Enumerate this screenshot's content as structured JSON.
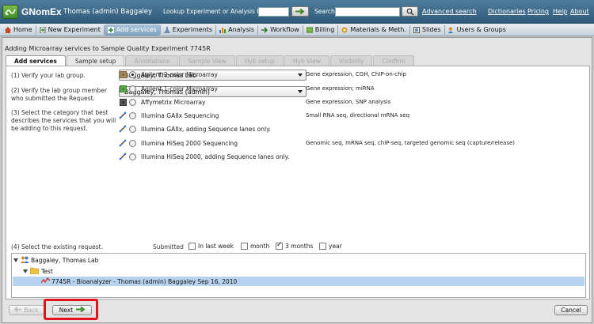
{
  "app": {
    "name": "GNomEx",
    "user": "Thomas (admin) Baggaley"
  },
  "topbar": {
    "lookup_label": "Lookup Experiment or Analysis by #",
    "search_label": "Search",
    "advanced_search": "Advanced search",
    "links": [
      "Dictionaries",
      "Pricing",
      "Help",
      "About"
    ]
  },
  "nav": {
    "items": [
      {
        "label": "Home",
        "icon": "home-icon",
        "active": false
      },
      {
        "label": "New Experiment",
        "icon": "new-experiment-icon",
        "active": false
      },
      {
        "label": "Add services",
        "icon": "add-services-icon",
        "active": true
      },
      {
        "label": "Experiments",
        "icon": "flask-icon",
        "active": false
      },
      {
        "label": "Analysis",
        "icon": "chart-icon",
        "active": false
      },
      {
        "label": "Workflow",
        "icon": "workflow-icon",
        "active": false
      },
      {
        "label": "Billing",
        "icon": "billing-icon",
        "active": false
      },
      {
        "label": "Materials & Meth.",
        "icon": "materials-icon",
        "active": false
      },
      {
        "label": "Slides",
        "icon": "slides-icon",
        "active": false
      },
      {
        "label": "Users & Groups",
        "icon": "users-icon",
        "active": false
      }
    ]
  },
  "page": {
    "title": "Adding Microarray services to Sample Quality Experiment 7745R",
    "tabs": [
      {
        "label": "Add services",
        "state": "active"
      },
      {
        "label": "Sample setup",
        "state": "enabled"
      },
      {
        "label": "Annotations",
        "state": "disabled"
      },
      {
        "label": "Sample View",
        "state": "disabled"
      },
      {
        "label": "Hyb setup",
        "state": "disabled"
      },
      {
        "label": "Hyb View",
        "state": "disabled"
      },
      {
        "label": "Visibility",
        "state": "disabled"
      },
      {
        "label": "Confirm",
        "state": "disabled"
      }
    ]
  },
  "form": {
    "q1": "(1) Verify your lab group.",
    "lab_group": "Baggaley, Thomas Lab",
    "q2": "(2) Verify the lab group member who submitted the Request.",
    "member": "Baggaley, Thomas (admin)",
    "q3": "(3) Select the category that best describes the services that you will be adding to this request.",
    "categories": [
      {
        "label": "Agilent 2-color Microarray",
        "desc": "Gene expression, CGH, ChIP-on-chip",
        "selected": true,
        "icon": "agilent-2color-icon",
        "color": "#8a6d3b"
      },
      {
        "label": "Agilent 1-color Microarray",
        "desc": "Gene expression; miRNA",
        "selected": false,
        "icon": "agilent-1color-icon",
        "color": "#3e8e2c"
      },
      {
        "label": "Affymetrix Microarray",
        "desc": "Gene expression, SNP analysis",
        "selected": false,
        "icon": "affymetrix-icon",
        "color": "#333333"
      },
      {
        "label": "Illumina GAIIx Sequencing",
        "desc": "Small RNA seq, directional mRNA seq",
        "selected": false,
        "icon": "dna-icon",
        "color": "#3a6fc4"
      },
      {
        "label": "Illumina GAIIx, adding Sequence lanes only.",
        "desc": "",
        "selected": false,
        "icon": "dna-icon",
        "color": "#3a6fc4"
      },
      {
        "label": "Illumina HiSeq 2000 Sequencing",
        "desc": "Genomic seq, mRNA seq, chIP-seq, targeted genomic seq (capture/release)",
        "selected": false,
        "icon": "dna-icon",
        "color": "#3a6fc4"
      },
      {
        "label": "Illumina HiSeq 2000, adding Sequence lanes only.",
        "desc": "",
        "selected": false,
        "icon": "dna-icon",
        "color": "#3a6fc4"
      }
    ],
    "q4": "(4) Select the existing request.",
    "submitted_label": "Submitted",
    "filters": [
      {
        "label": "In last week",
        "checked": false
      },
      {
        "label": "month",
        "checked": false
      },
      {
        "label": "3 months",
        "checked": true
      },
      {
        "label": "year",
        "checked": false
      }
    ],
    "tree": {
      "lab": "Baggaley, Thomas Lab",
      "folder": "Test",
      "request": "7745R - Bioanalyzer - Thomas (admin) Baggaley Sep 16, 2010"
    }
  },
  "buttons": {
    "back": "Back",
    "next": "Next",
    "cancel": "Cancel"
  }
}
